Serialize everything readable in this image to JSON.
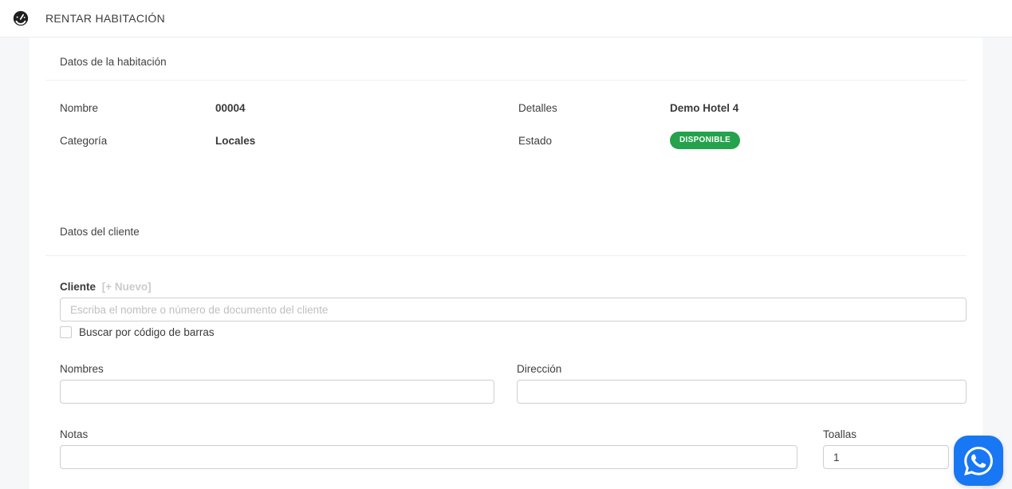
{
  "header": {
    "title": "RENTAR HABITACIÓN",
    "logo_icon": "gauge-icon"
  },
  "room_section": {
    "heading": "Datos de la habitación",
    "nombre": {
      "label": "Nombre",
      "value": "00004"
    },
    "detalles": {
      "label": "Detalles",
      "value": "Demo Hotel 4"
    },
    "categoria": {
      "label": "Categoría",
      "value": "Locales"
    },
    "estado": {
      "label": "Estado",
      "badge": "DISPONIBLE",
      "badge_color": "#24a24c"
    }
  },
  "client_section": {
    "heading": "Datos del cliente",
    "cliente_label": "Cliente",
    "nuevo_link": "[+ Nuevo]",
    "search": {
      "placeholder": "Escriba el nombre o número de documento del cliente",
      "value": ""
    },
    "barcode_checkbox": {
      "label": "Buscar por código de barras",
      "checked": false
    },
    "nombres": {
      "label": "Nombres",
      "value": ""
    },
    "direccion": {
      "label": "Dirección",
      "value": ""
    },
    "notas": {
      "label": "Notas",
      "value": ""
    },
    "toallas": {
      "label": "Toallas",
      "value": "1"
    }
  },
  "floating": {
    "whatsapp_icon": "whatsapp-icon",
    "color": "#1877F2"
  }
}
